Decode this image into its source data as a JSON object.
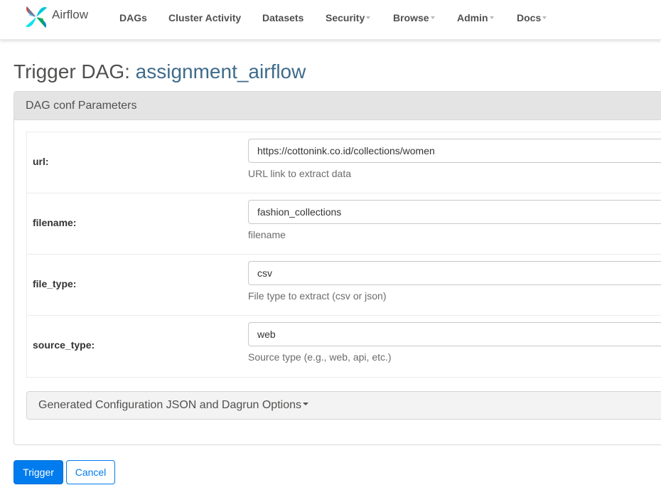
{
  "navbar": {
    "brand": "Airflow",
    "items": [
      {
        "label": "DAGs",
        "dropdown": false
      },
      {
        "label": "Cluster Activity",
        "dropdown": false
      },
      {
        "label": "Datasets",
        "dropdown": false
      },
      {
        "label": "Security",
        "dropdown": true
      },
      {
        "label": "Browse",
        "dropdown": true
      },
      {
        "label": "Admin",
        "dropdown": true
      },
      {
        "label": "Docs",
        "dropdown": true
      }
    ]
  },
  "page": {
    "title_prefix": "Trigger DAG:",
    "dag_id": "assignment_airflow"
  },
  "panel": {
    "heading": "DAG conf Parameters",
    "params": [
      {
        "label": "url:",
        "value": "https://cottonink.co.id/collections/women",
        "description": "URL link to extract data"
      },
      {
        "label": "filename:",
        "value": "fashion_collections",
        "description": "filename"
      },
      {
        "label": "file_type:",
        "value": "csv",
        "description": "File type to extract (csv or json)"
      },
      {
        "label": "source_type:",
        "value": "web",
        "description": "Source type (e.g., web, api, etc.)"
      }
    ],
    "collapse_label": "Generated Configuration JSON and Dagrun Options"
  },
  "actions": {
    "trigger": "Trigger",
    "cancel": "Cancel"
  },
  "colors": {
    "primary": "#017cee",
    "nav_text": "#51504f",
    "dag_link": "#3e6b8a"
  }
}
